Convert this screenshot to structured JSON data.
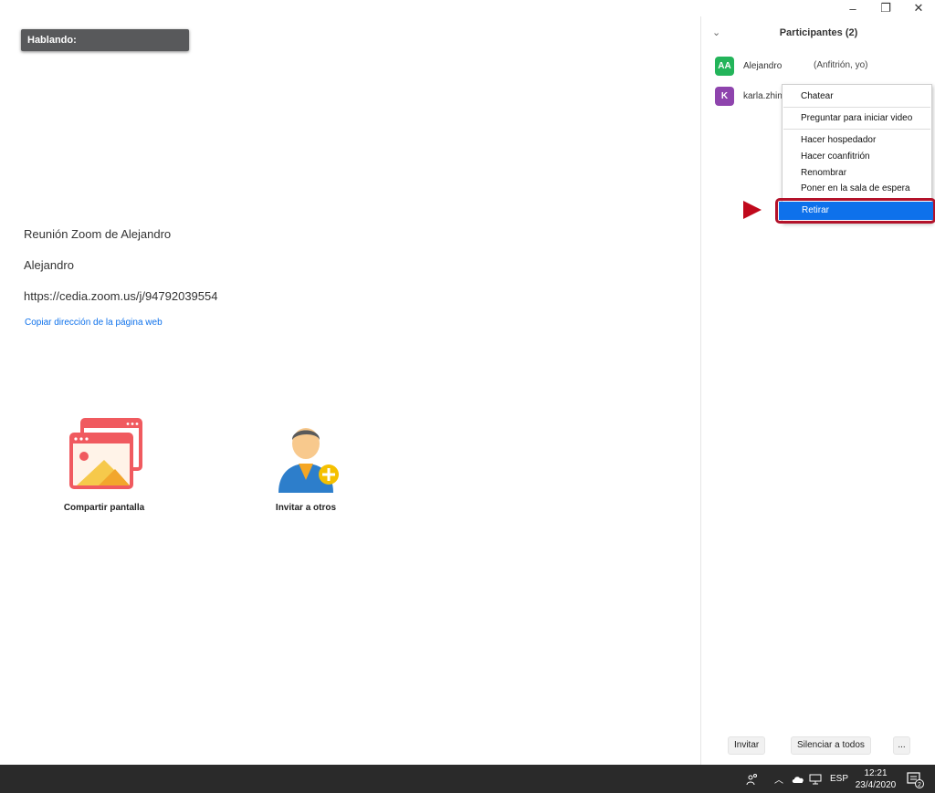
{
  "window": {
    "minimize_glyph": "–",
    "maximize_glyph": "❐",
    "close_glyph": "✕"
  },
  "main": {
    "speaking_label": "Hablando:",
    "meeting_title": "Reunión Zoom de Alejandro",
    "host_name": "Alejandro",
    "meeting_url": "https://cedia.zoom.us/j/94792039554",
    "copy_link_label": "Copiar dirección de la página web",
    "actions": [
      {
        "label": "Compartir pantalla",
        "icon": "share-screen-icon"
      },
      {
        "label": "Invitar a otros",
        "icon": "invite-person-icon"
      }
    ]
  },
  "panel": {
    "title": "Participantes (2)",
    "participants": [
      {
        "initials": "AA",
        "name": "Alejandro",
        "role": "(Anfitrión, yo)",
        "color": "#23b45a"
      },
      {
        "initials": "K",
        "name": "karla.zhin",
        "role": "",
        "color": "#8e44ad"
      }
    ],
    "context_menu": [
      {
        "label": "Chatear"
      },
      {
        "label": "Preguntar para iniciar video"
      },
      {
        "label": "Hacer hospedador"
      },
      {
        "label": "Hacer coanfitrión"
      },
      {
        "label": "Renombrar"
      },
      {
        "label": "Poner en la sala de espera"
      },
      {
        "label": "Retirar",
        "selected": true
      }
    ],
    "footer": {
      "invite_label": "Invitar",
      "mute_all_label": "Silenciar a todos",
      "more_label": "..."
    }
  },
  "taskbar": {
    "language": "ESP",
    "time": "12:21",
    "date": "23/4/2020",
    "notification_count": "2"
  },
  "colors": {
    "accent": "#0e71eb",
    "highlight_border": "#b3122a",
    "taskbar": "#2a2a2a"
  }
}
